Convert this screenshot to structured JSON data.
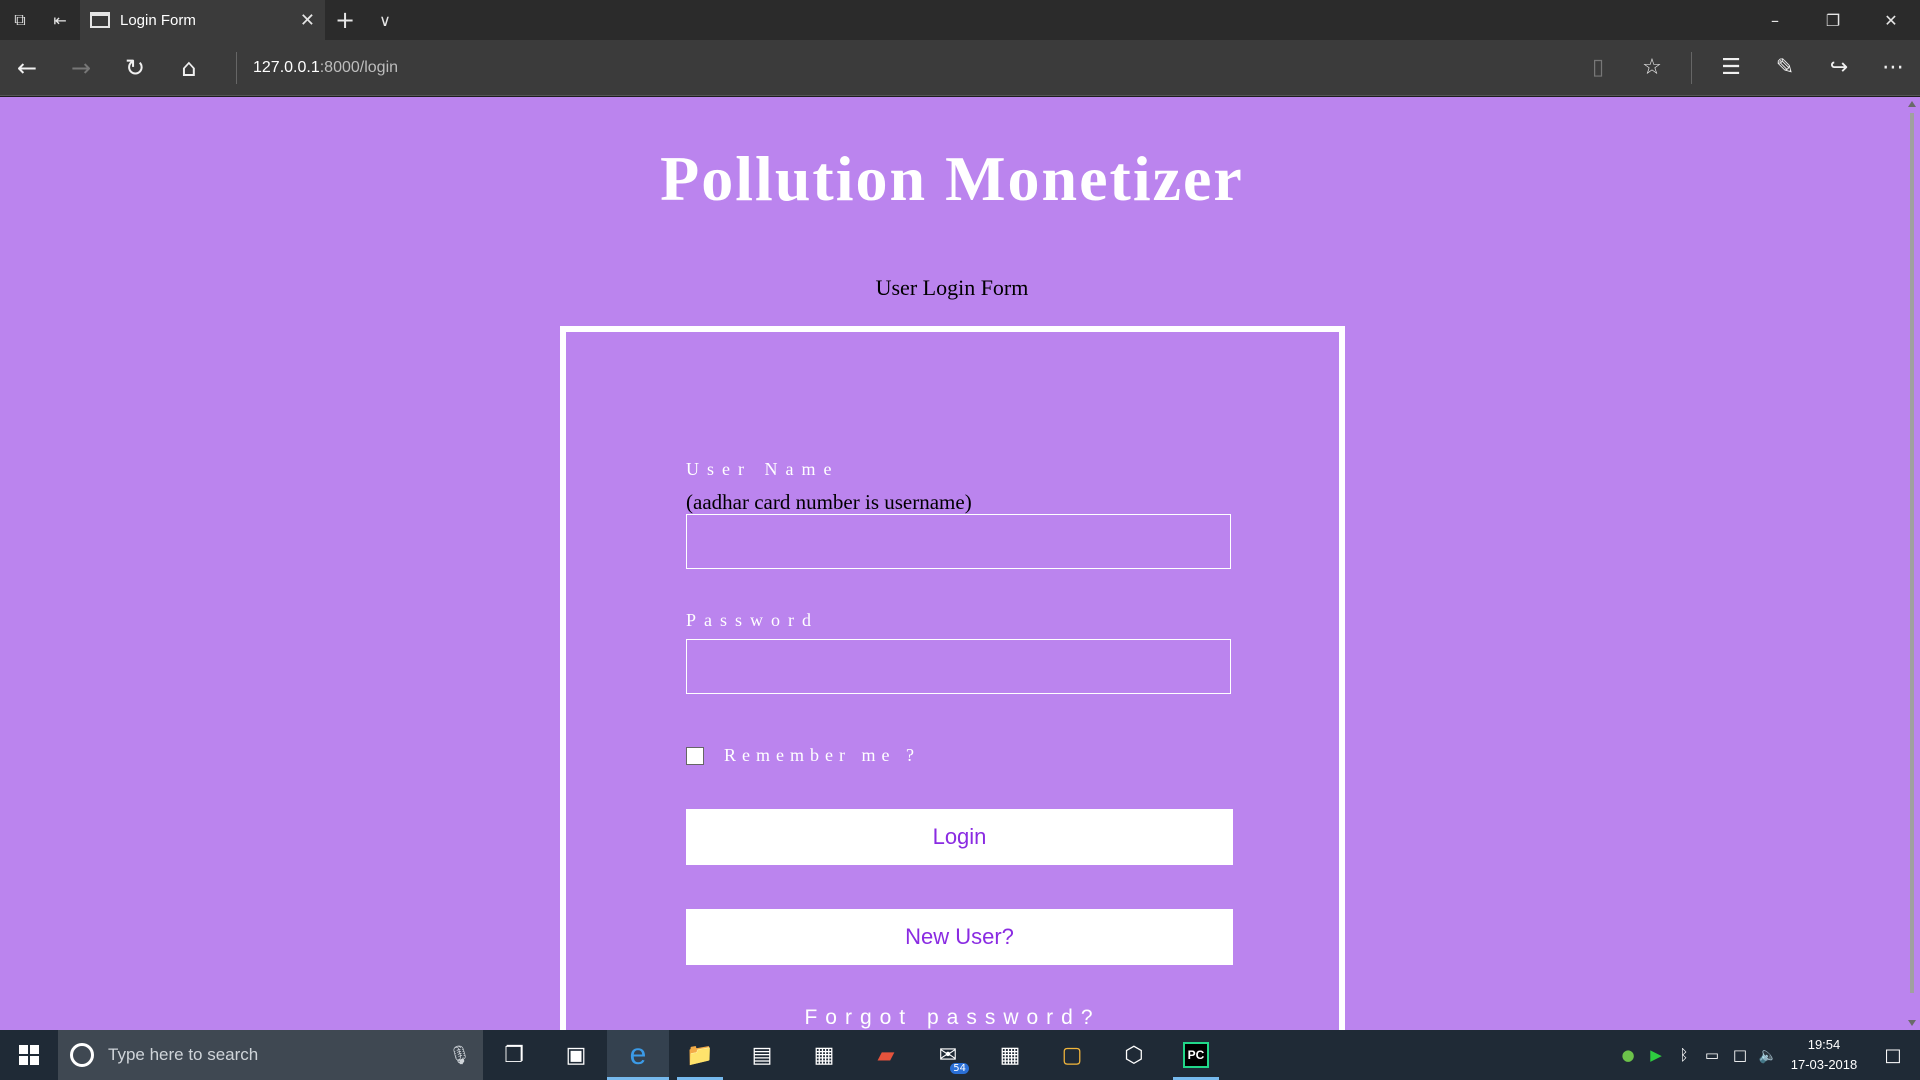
{
  "browser": {
    "tab_title": "Login Form",
    "url_host": "127.0.0.1",
    "url_path": ":8000/login",
    "icons": {
      "tab_preview": "⧉",
      "set_aside": "⇤",
      "tab_close": "✕",
      "new_tab": "+",
      "tab_list": "∨",
      "minimize": "–",
      "restore": "❐",
      "close": "✕",
      "back": "←",
      "forward": "→",
      "refresh": "↻",
      "home": "⌂",
      "reading_view": "▯",
      "favorite": "☆",
      "favorites_hub": "☰",
      "notes": "✎",
      "share": "↪",
      "more": "⋯"
    }
  },
  "page": {
    "title": "Pollution Monetizer",
    "form_heading": "User Login Form",
    "username": {
      "label": "User Name",
      "hint": "(aadhar card number is username)",
      "value": ""
    },
    "password": {
      "label": "Password",
      "value": ""
    },
    "remember_label": "Remember me ?",
    "remember_checked": false,
    "login_button": "Login",
    "new_user_button": "New User?",
    "forgot_link": "Forgot password?"
  },
  "taskbar": {
    "search_placeholder": "Type here to search",
    "mail_badge": "54",
    "time": "19:54",
    "date": "17-03-2018",
    "icons": {
      "mic": "🎙",
      "task_view": "❐",
      "mysql": "▣",
      "edge": "e",
      "explorer": "📁",
      "app": "▤",
      "store": "▦",
      "wps": "▰",
      "mail": "✉",
      "calculator": "▦",
      "outlook": "▢",
      "virtualbox": "⬡",
      "pycharm": "PC",
      "tray1": "●",
      "tray2": "▶",
      "bluetooth": "ᛒ",
      "battery": "▭",
      "network": "□",
      "volume": "🔈",
      "notifications": "□"
    }
  }
}
